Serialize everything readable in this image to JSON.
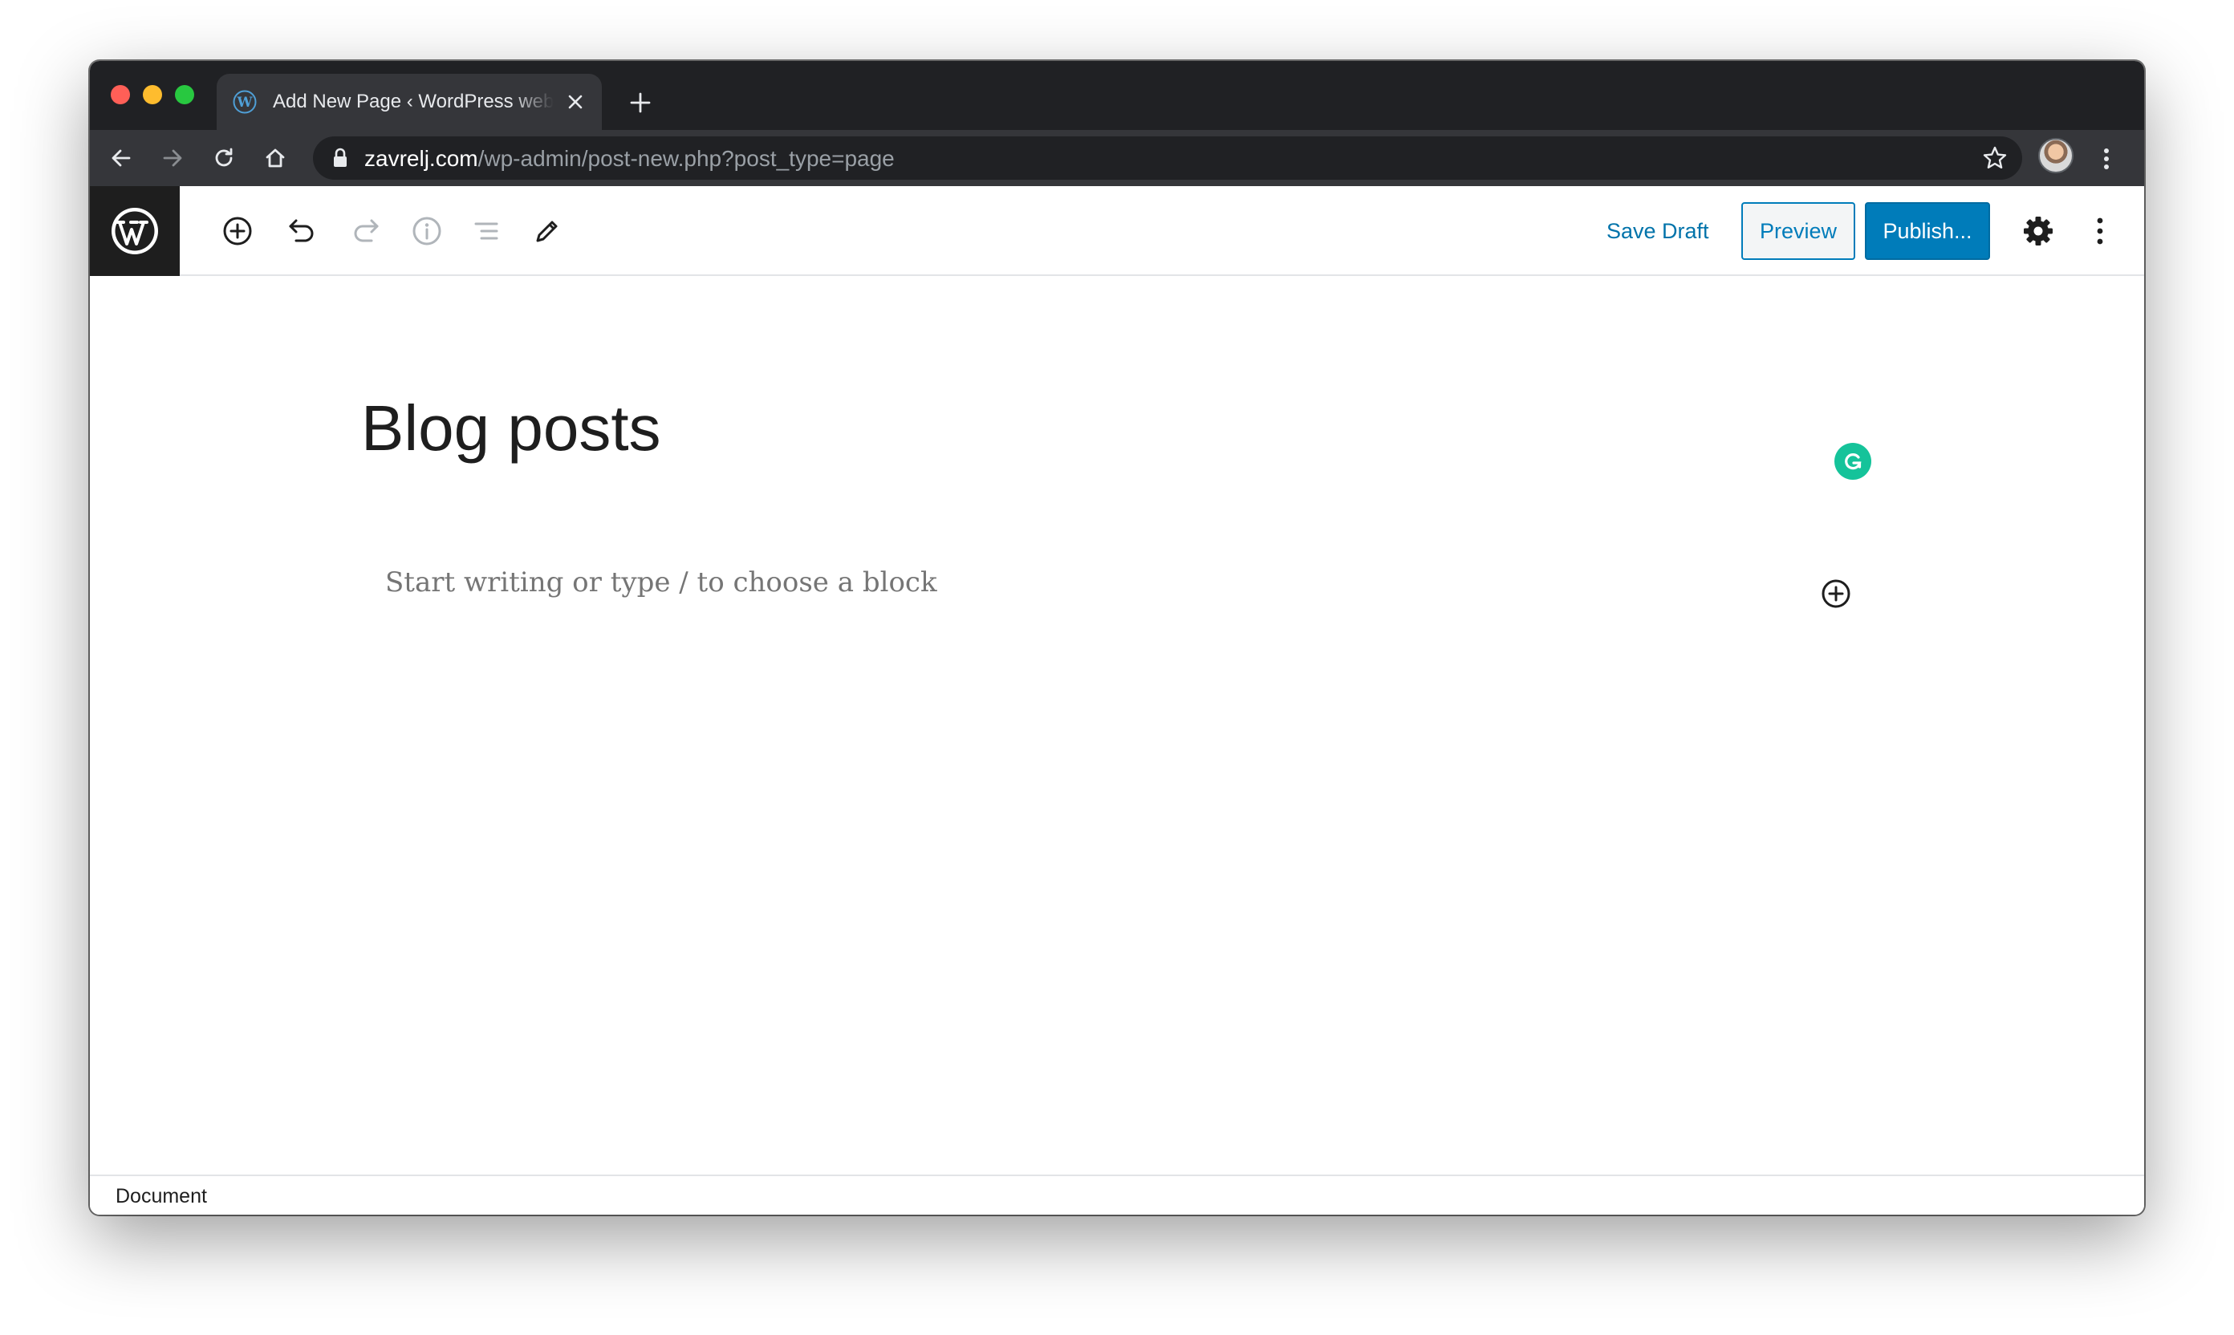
{
  "browser": {
    "tab_title": "Add New Page ‹ WordPress website",
    "url_host": "zavrelj.com",
    "url_path": "/wp-admin/post-new.php?post_type=page",
    "icons": {
      "back": "arrow-left-icon",
      "forward": "arrow-right-icon",
      "reload": "reload-icon",
      "home": "home-icon",
      "lock": "lock-icon",
      "bookmark": "star-icon",
      "menu": "kebab-menu-icon"
    },
    "colors": {
      "frame": "#202124",
      "toolbar": "#35363a",
      "close": "#ff5f57",
      "minimize": "#febc2e",
      "maximize": "#28c840"
    }
  },
  "editor": {
    "toolbar": {
      "save_draft": "Save Draft",
      "preview": "Preview",
      "publish": "Publish..."
    },
    "title": "Blog posts",
    "block_placeholder": "Start writing or type / to choose a block",
    "footer_breadcrumb": "Document",
    "colors": {
      "accent": "#007cba",
      "link": "#0073aa",
      "grammarly": "#15c39a"
    }
  }
}
